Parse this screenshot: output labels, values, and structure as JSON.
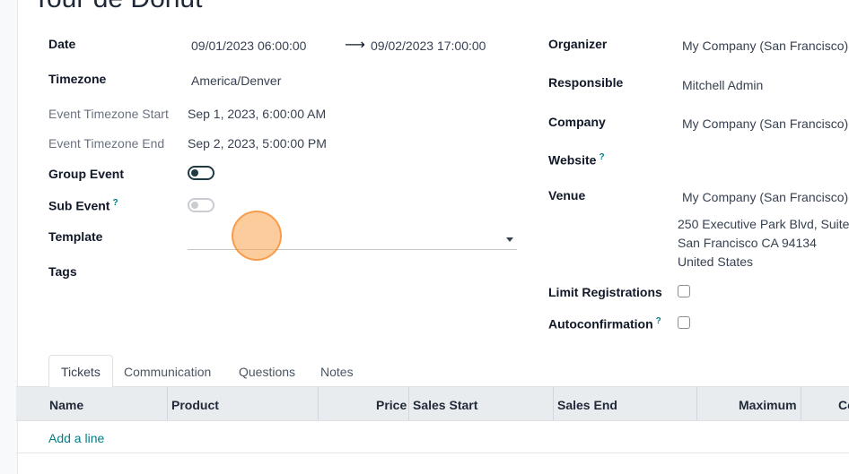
{
  "title": "Tour de Donut",
  "left": {
    "date_label": "Date",
    "date_start": "09/01/2023 06:00:00",
    "date_arrow": "⟶",
    "date_end": "09/02/2023 17:00:00",
    "timezone_label": "Timezone",
    "timezone_value": "America/Denver",
    "tz_start_label": "Event Timezone Start",
    "tz_start_value": "Sep 1, 2023, 6:00:00 AM",
    "tz_end_label": "Event Timezone End",
    "tz_end_value": "Sep 2, 2023, 5:00:00 PM",
    "group_event_label": "Group Event",
    "group_event_on": true,
    "sub_event_label": "Sub Event",
    "sub_event_help": "?",
    "sub_event_on": false,
    "template_label": "Template",
    "template_value": "",
    "tags_label": "Tags"
  },
  "right": {
    "organizer_label": "Organizer",
    "organizer_value": "My Company (San Francisco)",
    "responsible_label": "Responsible",
    "responsible_value": "Mitchell Admin",
    "company_label": "Company",
    "company_value": "My Company (San Francisco)",
    "website_label": "Website",
    "website_help": "?",
    "venue_label": "Venue",
    "venue_value": "My Company (San Francisco)",
    "venue_address_1": "250 Executive Park Blvd, Suite",
    "venue_address_2": "San Francisco CA 94134",
    "venue_address_3": "United States",
    "limit_label": "Limit Registrations",
    "autoconfirm_label": "Autoconfirmation",
    "autoconfirm_help": "?"
  },
  "tabs": [
    "Tickets",
    "Communication",
    "Questions",
    "Notes"
  ],
  "table": {
    "columns": [
      "Name",
      "Product",
      "Price",
      "Sales Start",
      "Sales End",
      "Maximum",
      "Co"
    ],
    "add_line": "Add a line"
  },
  "colors": {
    "accent": "#017e84",
    "cursor_highlight": "#fca34c"
  }
}
